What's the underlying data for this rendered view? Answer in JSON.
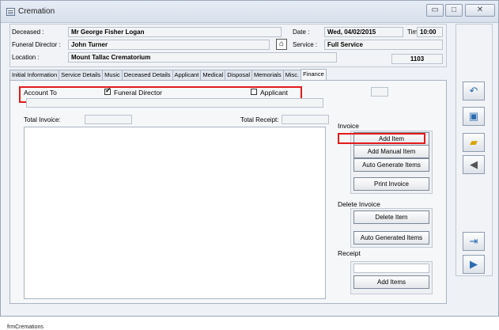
{
  "window": {
    "title": "Cremation"
  },
  "titlebar": {
    "minimize": "▭",
    "restore": "□",
    "close": "✕"
  },
  "header": {
    "deceased_label": "Deceased :",
    "deceased_value": "Mr George Fisher Logan",
    "director_label": "Funeral Director :",
    "director_value": "John Turner",
    "location_label": "Location :",
    "location_value": "Mount Tallac Crematorium",
    "date_label": "Date :",
    "date_value": "Wed, 04/02/2015",
    "time_label": "Time :",
    "time_value": "10:00",
    "service_label": "Service :",
    "service_value": "Full Service",
    "number_value": "1103"
  },
  "tabs": [
    "Initial Information",
    "Service Details",
    "Music",
    "Deceased Details",
    "Applicant",
    "Medical",
    "Disposal",
    "Memorials",
    "Misc.",
    "Finance"
  ],
  "finance": {
    "account_to_label": "Account To",
    "funeral_director_label": "Funeral Director",
    "funeral_director_checked": true,
    "applicant_label": "Applicant",
    "applicant_checked": false,
    "total_invoice_label": "Total Invoice:",
    "total_invoice_value": "",
    "total_receipt_label": "Total Receipt:",
    "total_receipt_value": "",
    "invoice_section_label": "Invoice",
    "add_item": "Add Item",
    "add_manual_item": "Add Manual Item",
    "auto_generate_items": "Auto Generate Items",
    "print_invoice": "Print Invoice",
    "delete_invoice_label": "Delete Invoice",
    "delete_item": "Delete  Item",
    "auto_generated_items": "Auto Generated Items",
    "receipt_label": "Receipt",
    "receipt_value": "",
    "receipt_add_items": "Add Items"
  },
  "sidebar_icons": [
    "undo-icon",
    "save-icon",
    "folder-icon",
    "speaker-icon",
    "exit-icon",
    "next-record-icon"
  ],
  "status": {
    "form_name": "frmCremations"
  },
  "colors": {
    "highlight": "#e41b1b",
    "window_bg": "#eef1f6"
  }
}
